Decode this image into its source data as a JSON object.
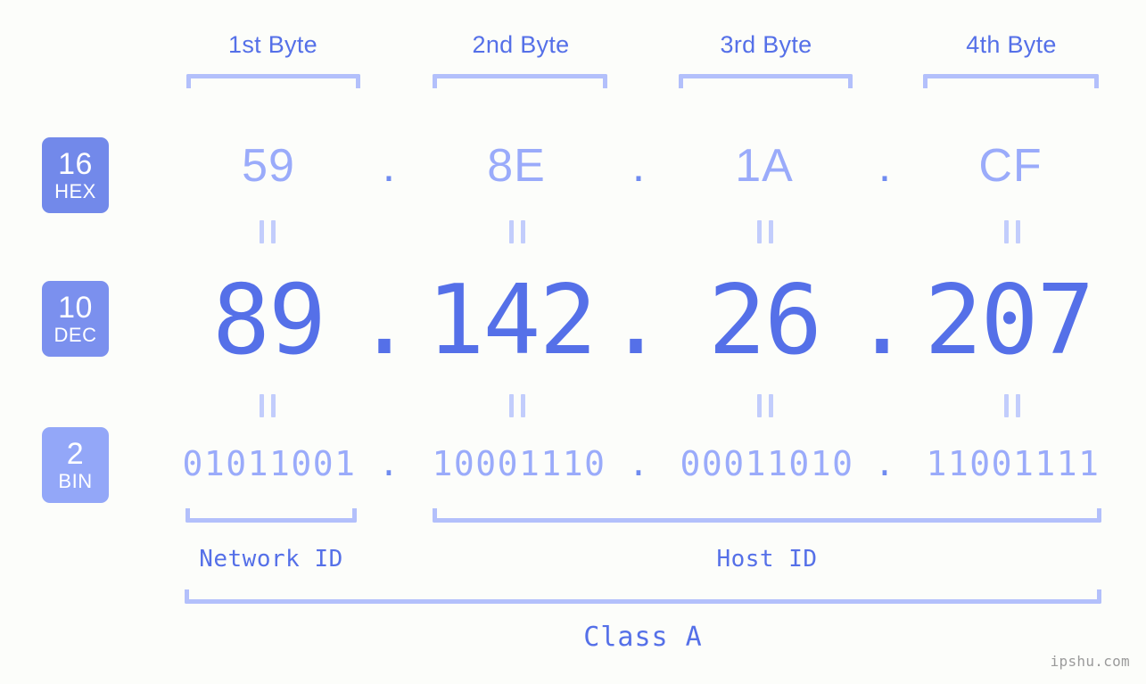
{
  "colors": {
    "background": "#fcfdfa",
    "primary_blue": "#5570e8",
    "light_blue": "#9aabfa",
    "bracket_blue": "#b3c0fb",
    "badge_hex": "#7289ea",
    "badge_dec": "#7b90ee",
    "badge_bin": "#93a7f8",
    "watermark_gray": "#9b9b9b"
  },
  "byte_headers": [
    {
      "label": "1st Byte"
    },
    {
      "label": "2nd Byte"
    },
    {
      "label": "3rd Byte"
    },
    {
      "label": "4th Byte"
    }
  ],
  "badges": [
    {
      "base": "16",
      "name": "HEX"
    },
    {
      "base": "10",
      "name": "DEC"
    },
    {
      "base": "2",
      "name": "BIN"
    }
  ],
  "rows": {
    "hex": {
      "octets": [
        "59",
        "8E",
        "1A",
        "CF"
      ],
      "separator": "."
    },
    "dec": {
      "octets": [
        "89",
        "142",
        "26",
        "207"
      ],
      "separator": "."
    },
    "bin": {
      "octets": [
        "01011001",
        "10001110",
        "00011010",
        "11001111"
      ],
      "separator": "."
    }
  },
  "equality_symbol": "||",
  "id_sections": [
    {
      "label": "Network ID"
    },
    {
      "label": "Host ID"
    }
  ],
  "class_label": "Class A",
  "watermark": "ipshu.com"
}
